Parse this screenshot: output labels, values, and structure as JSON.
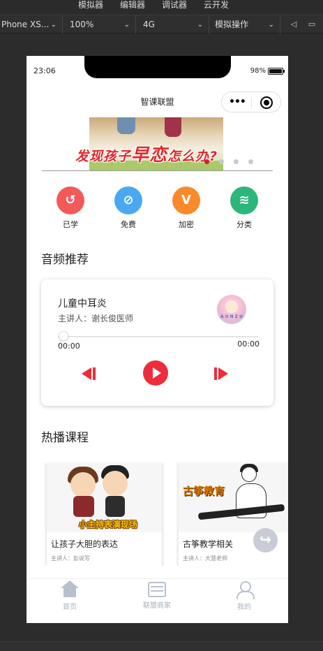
{
  "ide": {
    "menus": [
      "模拟器",
      "编辑器",
      "调试器",
      "云开发"
    ],
    "device": "Phone XS...",
    "zoom": "100%",
    "network": "4G",
    "sim_ops": "模拟操作"
  },
  "status": {
    "time": "23:06",
    "battery": "98%"
  },
  "nav": {
    "title": "智课联盟"
  },
  "banner": {
    "text_pre": "发现孩子",
    "text_big": "早恋",
    "text_post": "怎么办?",
    "slide_count": 4,
    "active_slide": 0
  },
  "categories": [
    {
      "label": "已学",
      "color": "#f25a5a",
      "icon": "history-icon",
      "glyph": "↺"
    },
    {
      "label": "免费",
      "color": "#4aa8f0",
      "icon": "free-icon",
      "glyph": "⊘"
    },
    {
      "label": "加密",
      "color": "#f98a2b",
      "icon": "vip-icon",
      "glyph": "V"
    },
    {
      "label": "分类",
      "color": "#2cb67a",
      "icon": "layers-icon",
      "glyph": "≋"
    }
  ],
  "audio": {
    "section_title": "音频推荐",
    "title": "儿童中耳炎",
    "speaker": "主讲人：谢长俊医师",
    "current_time": "00:00",
    "total_time": "00:00",
    "progress": 0,
    "avatar_text": "A U N Z U"
  },
  "hot": {
    "section_title": "热播课程",
    "courses": [
      {
        "title": "让孩子大胆的表达",
        "speaker": "主讲人：彭说写",
        "tag": "小主持表演现场"
      },
      {
        "title": "古筝教学相关",
        "speaker": "主讲人：大慧老师",
        "tag": "古筝教育"
      }
    ]
  },
  "tabs": [
    {
      "label": "首页"
    },
    {
      "label": "联盟商家"
    },
    {
      "label": "我的"
    }
  ]
}
